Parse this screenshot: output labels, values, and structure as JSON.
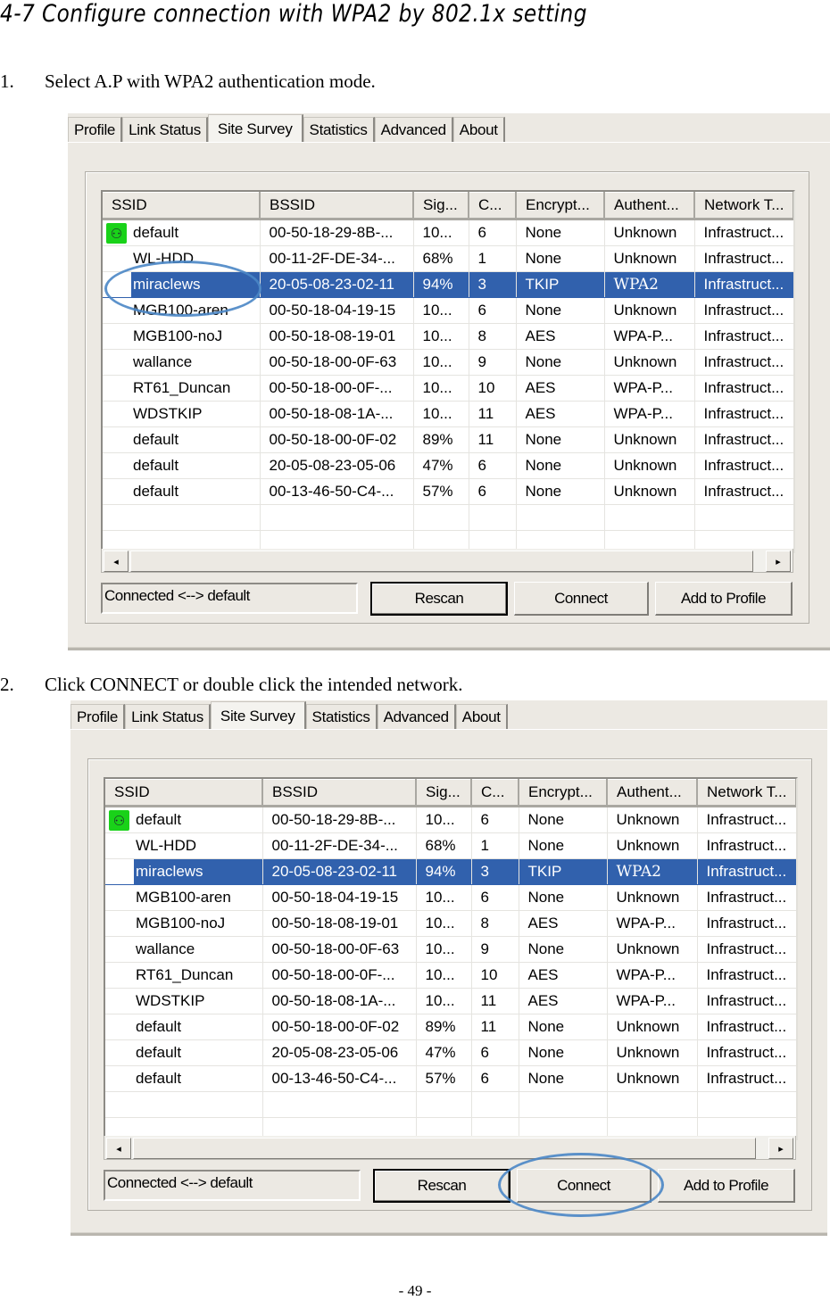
{
  "heading": "4-7   Configure connection with WPA2 by 802.1x setting",
  "steps": [
    {
      "number": "1.",
      "text": "Select A.P with WPA2 authentication mode."
    },
    {
      "number": "2.",
      "text": "Click CONNECT or double click the intended network."
    }
  ],
  "dialog": {
    "tabs": [
      {
        "label": "Profile",
        "active": false
      },
      {
        "label": "Link Status",
        "active": false
      },
      {
        "label": "Site Survey",
        "active": true
      },
      {
        "label": "Statistics",
        "active": false
      },
      {
        "label": "Advanced",
        "active": false
      },
      {
        "label": "About",
        "active": false
      }
    ],
    "columns": [
      "SSID",
      "BSSID",
      "Sig...",
      "C...",
      "Encrypt...",
      "Authent...",
      "Network T..."
    ],
    "rows": [
      {
        "ssid": "default",
        "bssid": "00-50-18-29-8B-...",
        "signal": "10...",
        "channel": "6",
        "encryption": "None",
        "auth": "Unknown",
        "network": "Infrastruct...",
        "connected": true,
        "selected": false
      },
      {
        "ssid": "WL-HDD",
        "bssid": "00-11-2F-DE-34-...",
        "signal": "68%",
        "channel": "1",
        "encryption": "None",
        "auth": "Unknown",
        "network": "Infrastruct...",
        "connected": false,
        "selected": false
      },
      {
        "ssid": "miraclews",
        "bssid": "20-05-08-23-02-11",
        "signal": "94%",
        "channel": "3",
        "encryption": "TKIP",
        "auth": "WPA2",
        "network": "Infrastruct...",
        "connected": false,
        "selected": true
      },
      {
        "ssid": "MGB100-aren",
        "bssid": "00-50-18-04-19-15",
        "signal": "10...",
        "channel": "6",
        "encryption": "None",
        "auth": "Unknown",
        "network": "Infrastruct...",
        "connected": false,
        "selected": false
      },
      {
        "ssid": "MGB100-noJ",
        "bssid": "00-50-18-08-19-01",
        "signal": "10...",
        "channel": "8",
        "encryption": "AES",
        "auth": "WPA-P...",
        "network": "Infrastruct...",
        "connected": false,
        "selected": false
      },
      {
        "ssid": "wallance",
        "bssid": "00-50-18-00-0F-63",
        "signal": "10...",
        "channel": "9",
        "encryption": "None",
        "auth": "Unknown",
        "network": "Infrastruct...",
        "connected": false,
        "selected": false
      },
      {
        "ssid": "RT61_Duncan",
        "bssid": "00-50-18-00-0F-...",
        "signal": "10...",
        "channel": "10",
        "encryption": "AES",
        "auth": "WPA-P...",
        "network": "Infrastruct...",
        "connected": false,
        "selected": false
      },
      {
        "ssid": "WDSTKIP",
        "bssid": "00-50-18-08-1A-...",
        "signal": "10...",
        "channel": "11",
        "encryption": "AES",
        "auth": "WPA-P...",
        "network": "Infrastruct...",
        "connected": false,
        "selected": false
      },
      {
        "ssid": "default",
        "bssid": "00-50-18-00-0F-02",
        "signal": "89%",
        "channel": "11",
        "encryption": "None",
        "auth": "Unknown",
        "network": "Infrastruct...",
        "connected": false,
        "selected": false
      },
      {
        "ssid": "default",
        "bssid": "20-05-08-23-05-06",
        "signal": "47%",
        "channel": "6",
        "encryption": "None",
        "auth": "Unknown",
        "network": "Infrastruct...",
        "connected": false,
        "selected": false
      },
      {
        "ssid": "default",
        "bssid": "00-13-46-50-C4-...",
        "signal": "57%",
        "channel": "6",
        "encryption": "None",
        "auth": "Unknown",
        "network": "Infrastruct...",
        "connected": false,
        "selected": false
      }
    ],
    "status_text": "Connected <--> default",
    "buttons": {
      "rescan": "Rescan",
      "connect": "Connect",
      "add_to_profile": "Add to Profile"
    },
    "scroll_left_glyph": "◂",
    "scroll_right_glyph": "▸",
    "connected_icon_glyph": "⚇"
  },
  "annotations": {
    "highlight_color": "#4a86c5",
    "selection_color": "#3161ad",
    "shot1_highlight": "miraclews row",
    "shot2_highlight": "Connect button"
  },
  "page_number": "- 49 -"
}
